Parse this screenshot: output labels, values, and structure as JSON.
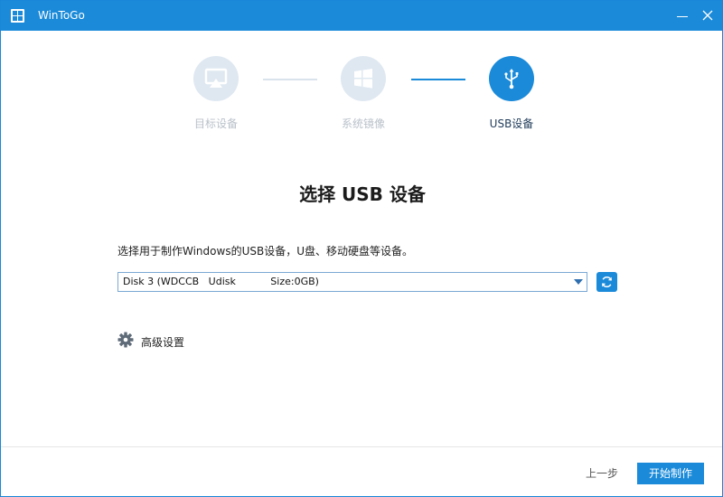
{
  "window": {
    "title": "WinToGo"
  },
  "steps": [
    {
      "label": "目标设备",
      "icon": "screen-cast-icon",
      "state": "done"
    },
    {
      "label": "系统镜像",
      "icon": "windows-logo-icon",
      "state": "done"
    },
    {
      "label": "USB设备",
      "icon": "usb-icon",
      "state": "current"
    }
  ],
  "main": {
    "heading": "选择 USB 设备",
    "instruction": "选择用于制作Windows的USB设备，U盘、移动硬盘等设备。",
    "device_select": {
      "value": "Disk 3 (WDCCB   Udisk           Size:0GB)"
    },
    "advanced_label": "高级设置"
  },
  "footer": {
    "back_label": "上一步",
    "start_label": "开始制作"
  },
  "colors": {
    "accent": "#1a8ad9",
    "step_inactive": "#dfe8f1",
    "step_label_inactive": "#b9c1ca"
  }
}
